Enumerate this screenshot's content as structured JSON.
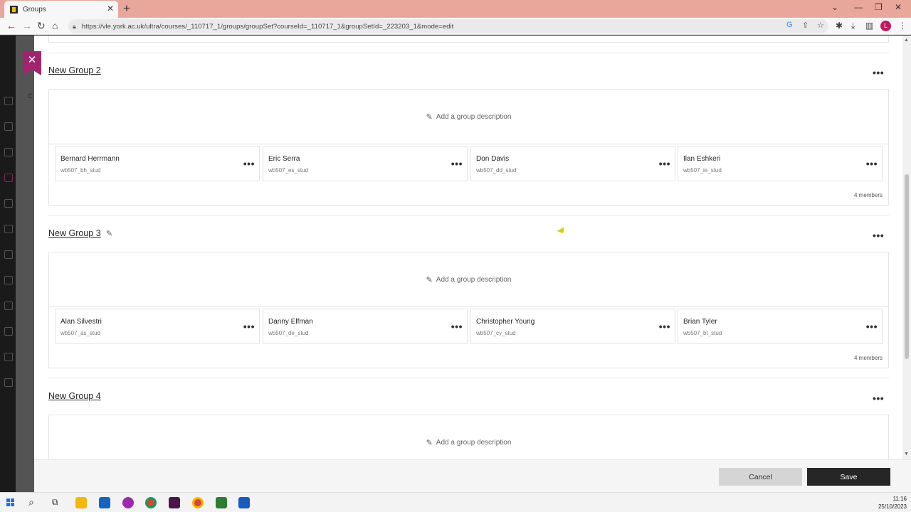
{
  "browser": {
    "tab_title": "Groups",
    "url": "https://vle.york.ac.uk/ultra/courses/_110717_1/groups/groupSet?courseId=_110717_1&groupSetId=_223203_1&mode=edit",
    "profile_initial": "L",
    "icons": [
      "back-icon",
      "forward-icon",
      "reload-icon",
      "home-icon",
      "lock-icon",
      "google-icon",
      "share-icon",
      "star-icon",
      "extensions-icon",
      "download-icon",
      "sidepanel-icon",
      "kebab-icon"
    ]
  },
  "background": {
    "hint_text": "C"
  },
  "groups": [
    {
      "title": "New Group 2",
      "description_placeholder": "Add a group description",
      "members": [
        {
          "name": "Bernard Herrmann",
          "uid": "wb507_bh_stud"
        },
        {
          "name": "Eric Serra",
          "uid": "wb507_es_stud"
        },
        {
          "name": "Don Davis",
          "uid": "wb507_dd_stud"
        },
        {
          "name": "Ilan Eshkeri",
          "uid": "wb507_ie_stud"
        }
      ],
      "member_count": "4 members"
    },
    {
      "title": "New Group 3",
      "description_placeholder": "Add a group description",
      "members": [
        {
          "name": "Alan Silvestri",
          "uid": "wb507_as_stud"
        },
        {
          "name": "Danny Elfman",
          "uid": "wb507_de_stud"
        },
        {
          "name": "Christopher Young",
          "uid": "wb507_cy_stud"
        },
        {
          "name": "Brian Tyler",
          "uid": "wb507_bt_stud"
        }
      ],
      "member_count": "4 members"
    },
    {
      "title": "New Group 4",
      "description_placeholder": "Add a group description"
    }
  ],
  "footer": {
    "cancel_label": "Cancel",
    "save_label": "Save"
  },
  "taskbar": {
    "time": "11:16",
    "date": "25/10/2023"
  },
  "colors": {
    "accent": "#a3246e",
    "save_bg": "#262626",
    "cancel_bg": "#d5d5d5"
  }
}
